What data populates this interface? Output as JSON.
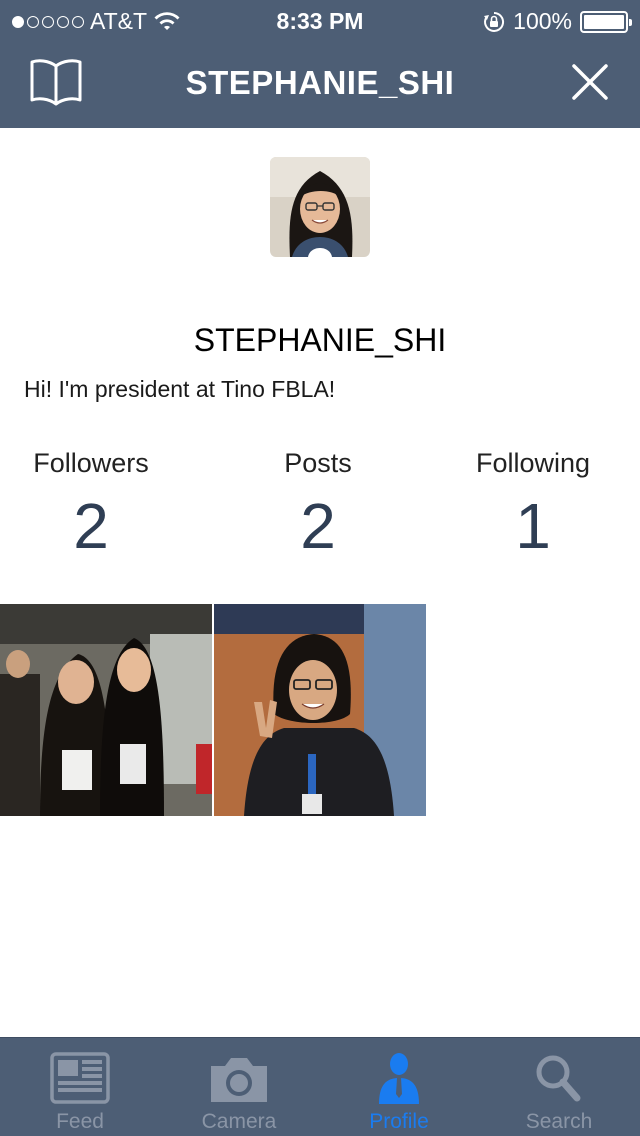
{
  "status_bar": {
    "carrier": "AT&T",
    "time": "8:33 PM",
    "battery": "100%",
    "signal_bars_filled": 1,
    "signal_bars_total": 5
  },
  "nav": {
    "title": "STEPHANIE_SHI",
    "left_icon": "book-icon",
    "right_icon": "close-icon"
  },
  "profile": {
    "username": "STEPHANIE_SHI",
    "bio": "Hi! I'm president at Tino FBLA!",
    "stats": [
      {
        "label": "Followers",
        "value": "2"
      },
      {
        "label": "Posts",
        "value": "2"
      },
      {
        "label": "Following",
        "value": "1"
      }
    ]
  },
  "posts_count_shown": 2,
  "tabs": [
    {
      "label": "Feed",
      "icon": "newspaper-icon",
      "active": false
    },
    {
      "label": "Camera",
      "icon": "camera-icon",
      "active": false
    },
    {
      "label": "Profile",
      "icon": "person-icon",
      "active": true
    },
    {
      "label": "Search",
      "icon": "search-icon",
      "active": false
    }
  ],
  "colors": {
    "bar_background": "#4d5e75",
    "active_tab": "#1a7cf0",
    "inactive_tab": "#8a95a6",
    "stat_value": "#2f3e54"
  }
}
